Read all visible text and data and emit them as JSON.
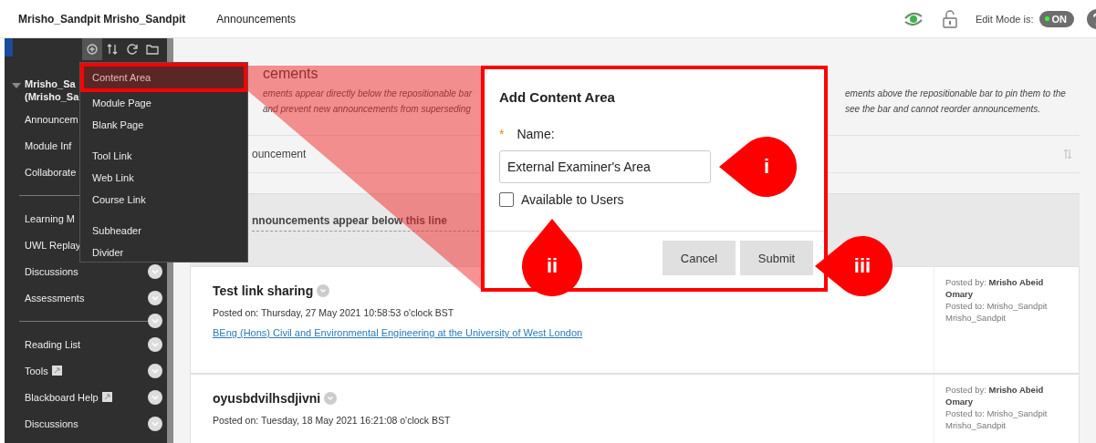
{
  "header": {
    "course_title": "Mrisho_Sandpit Mrisho_Sandpit",
    "breadcrumb": "Announcements",
    "edit_mode_label": "Edit Mode is:",
    "edit_mode": {
      "label": "ON",
      "on": true
    }
  },
  "sidebar": {
    "course": {
      "lines": [
        "Mrisho_Sa",
        "(Mrisho_Sa"
      ],
      "expanded": true
    },
    "items": [
      {
        "kind": "link",
        "label": "Announcem",
        "options": false,
        "external": false
      },
      {
        "kind": "link",
        "label": "Module Inf",
        "options": false,
        "external": false
      },
      {
        "kind": "link",
        "label": "Collaborate",
        "options": false,
        "external": false
      },
      {
        "kind": "divider",
        "options": false
      },
      {
        "kind": "link",
        "label": "Learning M",
        "options": false,
        "external": false
      },
      {
        "kind": "link",
        "label": "UWL Replay",
        "options": false,
        "external": false
      },
      {
        "kind": "link",
        "label": "Discussions",
        "options": true,
        "external": false
      },
      {
        "kind": "link",
        "label": "Assessments",
        "options": true,
        "external": false
      },
      {
        "kind": "divider",
        "options": true
      },
      {
        "kind": "link",
        "label": "Reading List",
        "options": true,
        "external": false
      },
      {
        "kind": "link",
        "label": "Tools",
        "options": true,
        "external": true
      },
      {
        "kind": "link",
        "label": "Blackboard Help",
        "options": true,
        "external": true
      },
      {
        "kind": "link",
        "label": "Discussions",
        "options": true,
        "external": false
      }
    ]
  },
  "add_menu": {
    "groups": [
      [
        {
          "label": "Content Area",
          "selected": true
        },
        {
          "label": "Module Page",
          "selected": false
        },
        {
          "label": "Blank Page",
          "selected": false
        }
      ],
      [
        {
          "label": "Tool Link",
          "selected": false
        },
        {
          "label": "Web Link",
          "selected": false
        },
        {
          "label": "Course Link",
          "selected": false
        }
      ],
      [
        {
          "label": "Subheader",
          "selected": false
        },
        {
          "label": "Divider",
          "selected": false
        }
      ]
    ]
  },
  "page": {
    "title": "cements",
    "intro_left": [
      "ements appear directly below the repositionable bar",
      "and prevent new announcements from superseding"
    ],
    "intro_right": [
      "ements above the repositionable bar to pin them to the",
      "see the bar and cannot reorder announcements."
    ],
    "create_button": "ouncement",
    "separator": "nnouncements appear below this line",
    "announcements": [
      {
        "title": "Test link sharing",
        "posted_on": "Posted on: Thursday, 27 May 2021 10:58:53 o'clock BST",
        "link": "BEng (Hons) Civil and Environmental Engineering at the University of West London",
        "posted_by": "Posted by: **Mrisho Abeid Omary**",
        "posted_to": "Posted to: Mrisho_Sandpit Mrisho_Sandpit"
      },
      {
        "title": "oyusbdvilhsdjivni",
        "posted_on": "Posted on: Tuesday, 18 May 2021 16:21:08 o'clock BST",
        "posted_by": "Posted by: **Mrisho Abeid Omary**",
        "posted_to": "Posted to: Mrisho_Sandpit Mrisho_Sandpit"
      }
    ]
  },
  "dialog": {
    "title": "Add Content Area",
    "required_mark": "*",
    "name_label": "Name:",
    "name_value": "External Examiner's Area",
    "available": {
      "label": "Available to Users",
      "checked": false
    },
    "buttons": [
      "Cancel",
      "Submit"
    ]
  },
  "callouts": [
    {
      "label": "i"
    },
    {
      "label": "ii"
    },
    {
      "label": "iii"
    }
  ]
}
